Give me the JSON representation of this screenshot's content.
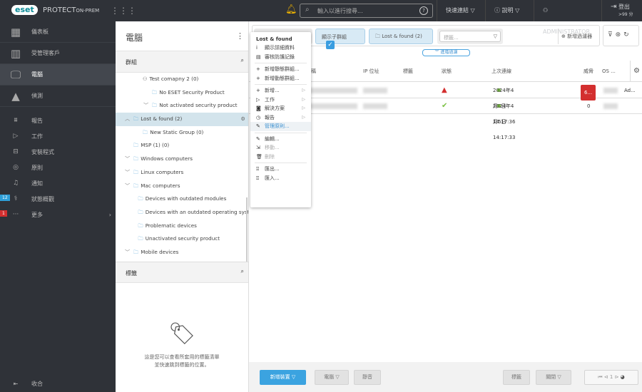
{
  "header": {
    "logo": "eset",
    "product": "PROTECT",
    "product_suffix": "ON-PREM",
    "search_placeholder": "輸入以進行搜尋...",
    "quick_links": "快速連結",
    "help": "說明",
    "user": "ADMINISTRATOR",
    "logout": "登出",
    "logout_time": ">99 分"
  },
  "sidebar": {
    "items": [
      {
        "label": "儀表板",
        "icon": "dashboard-icon"
      },
      {
        "label": "受管理客戶",
        "icon": "building-icon"
      },
      {
        "label": "電腦",
        "icon": "computer-icon"
      },
      {
        "label": "偵測",
        "icon": "warning-icon"
      },
      {
        "label": "報告",
        "icon": "report-icon"
      },
      {
        "label": "工作",
        "icon": "task-icon"
      },
      {
        "label": "安裝程式",
        "icon": "installer-icon"
      },
      {
        "label": "原則",
        "icon": "policy-icon"
      },
      {
        "label": "通知",
        "icon": "notification-icon"
      },
      {
        "label": "狀態概觀",
        "icon": "stethoscope-icon",
        "badge": "12",
        "badge_color": "#2e9fd8"
      },
      {
        "label": "更多",
        "icon": "more-icon",
        "badge": "1",
        "badge_color": "#d32f2f"
      }
    ],
    "collapse": "收合"
  },
  "panel": {
    "title": "電腦",
    "groups_label": "群組",
    "tags_label": "標籤",
    "tags_empty": "這是您可以查看所套用的標籤清單並快速跳到標籤的位置。",
    "tree": [
      {
        "label": "Test comapny 2 (0)",
        "indent": 2,
        "icon": "company"
      },
      {
        "label": "No ESET Security Product",
        "indent": 3,
        "icon": "folder"
      },
      {
        "label": "Not activated security product",
        "indent": 3,
        "chevron": "down",
        "icon": "folder"
      },
      {
        "label": "Lost & found (2)",
        "indent": 1,
        "chevron": "up",
        "icon": "folder",
        "selected": true
      },
      {
        "label": "New Static Group (0)",
        "indent": 2,
        "icon": "folder"
      },
      {
        "label": "MSP (1) (0)",
        "indent": 1,
        "icon": "folder"
      },
      {
        "label": "Windows computers",
        "indent": 1,
        "chevron": "down",
        "icon": "folder"
      },
      {
        "label": "Linux computers",
        "indent": 1,
        "chevron": "down",
        "icon": "folder"
      },
      {
        "label": "Mac computers",
        "indent": 1,
        "chevron": "down",
        "icon": "folder"
      },
      {
        "label": "Devices with outdated modules",
        "indent": 1.5,
        "icon": "folder"
      },
      {
        "label": "Devices with an outdated operating system",
        "indent": 1.5,
        "icon": "folder"
      },
      {
        "label": "Problematic devices",
        "indent": 1.5,
        "icon": "folder"
      },
      {
        "label": "Unactivated security product",
        "indent": 1.5,
        "icon": "folder"
      },
      {
        "label": "Mobile devices",
        "indent": 1,
        "chevron": "down",
        "icon": "folder"
      }
    ]
  },
  "filters": {
    "show_subgroups": "顯示子群組",
    "show_subgroups_checked": true,
    "group": "Lost & found (2)",
    "tags_placeholder": "標籤...",
    "add_filter": "新增過濾器",
    "advanced": "進階過濾"
  },
  "table": {
    "columns": [
      "名稱",
      "IP 位址",
      "標籤",
      "狀態",
      "上次連線",
      "威脅",
      "OS ..."
    ],
    "rows": [
      {
        "status": "warning",
        "last_connected": "2024年4月5日 14:17:36",
        "threats": "6...",
        "os_extra": "Ad..."
      },
      {
        "status": "ok",
        "last_connected": "2024年4月5日 14:17:33",
        "threats": "0",
        "os_extra": ""
      }
    ]
  },
  "context_menu": {
    "title": "Lost & found",
    "items": [
      {
        "label": "顯示詳細資料",
        "icon": "info-icon"
      },
      {
        "label": "審核防護記錄",
        "icon": "clipboard-icon"
      },
      {
        "sep": true
      },
      {
        "label": "新增靜態群組...",
        "icon": "plus-icon"
      },
      {
        "label": "新增動態群組...",
        "icon": "plus-icon"
      },
      {
        "sep": true
      },
      {
        "label": "新增...",
        "icon": "plus-icon",
        "sub": true
      },
      {
        "label": "工作",
        "icon": "play-icon",
        "sub": true
      },
      {
        "label": "解決方案",
        "icon": "solution-icon",
        "sub": true
      },
      {
        "label": "報告",
        "icon": "clock-icon",
        "sub": true
      },
      {
        "label": "管理原則...",
        "icon": "wrench-icon",
        "highlight": true
      },
      {
        "sep": true
      },
      {
        "label": "編輯...",
        "icon": "pencil-icon"
      },
      {
        "label": "移動...",
        "icon": "move-icon",
        "disabled": true
      },
      {
        "label": "刪除",
        "icon": "trash-icon",
        "disabled": true
      },
      {
        "sep": true
      },
      {
        "label": "匯出...",
        "icon": "export-icon"
      },
      {
        "label": "匯入...",
        "icon": "import-icon"
      }
    ]
  },
  "footer": {
    "add_device": "新增裝置",
    "computer": "電腦",
    "mute": "靜音",
    "tags": "標籤",
    "actions": "關閉",
    "page": "1"
  }
}
